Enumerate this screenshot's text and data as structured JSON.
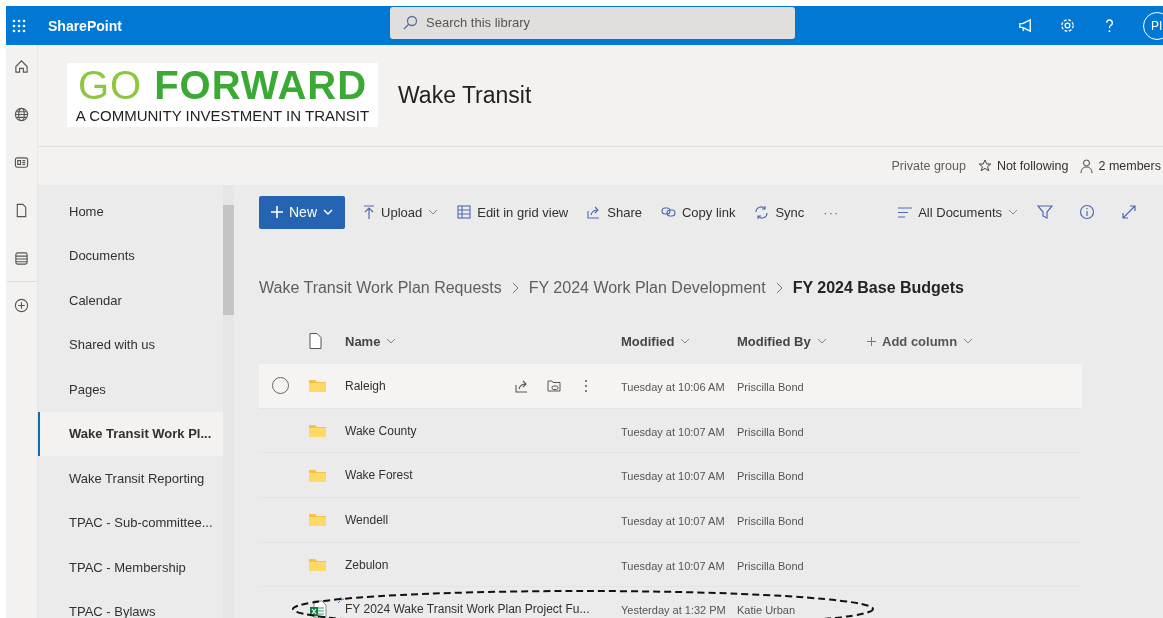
{
  "app_bar": {
    "app_name": "SharePoint",
    "search": {
      "placeholder": "Search this library"
    },
    "avatar": "PI"
  },
  "site": {
    "logo_line1a": "GO",
    "logo_line1b": "FORWARD",
    "logo_line2": "A COMMUNITY INVESTMENT IN TRANSIT",
    "title": "Wake Transit"
  },
  "site_info": {
    "privacy": "Private group",
    "follow": "Not following",
    "members": "2 members"
  },
  "nav": [
    {
      "label": "Home",
      "selected": false
    },
    {
      "label": "Documents",
      "selected": false
    },
    {
      "label": "Calendar",
      "selected": false
    },
    {
      "label": "Shared with us",
      "selected": false
    },
    {
      "label": "Pages",
      "selected": false
    },
    {
      "label": "Wake Transit Work Pl...",
      "selected": true
    },
    {
      "label": "Wake Transit Reporting",
      "selected": false
    },
    {
      "label": "TPAC - Sub-committee...",
      "selected": false
    },
    {
      "label": "TPAC - Membership",
      "selected": false
    },
    {
      "label": "TPAC - Bylaws",
      "selected": false
    }
  ],
  "commands": {
    "new": "New",
    "upload": "Upload",
    "grid": "Edit in grid view",
    "share": "Share",
    "copy_link": "Copy link",
    "sync": "Sync",
    "more": "···",
    "view": "All Documents"
  },
  "breadcrumb": [
    {
      "label": "Wake Transit Work Plan Requests",
      "current": false
    },
    {
      "label": "FY 2024 Work Plan Development",
      "current": false
    },
    {
      "label": "FY 2024 Base Budgets",
      "current": true
    }
  ],
  "table": {
    "columns": [
      "Name",
      "Modified",
      "Modified By",
      "Add column"
    ],
    "rows": [
      {
        "kind": "folder",
        "name": "Raleigh",
        "modified": "Tuesday at 10:06 AM",
        "modified_by": "Priscilla Bond",
        "hovered": true
      },
      {
        "kind": "folder",
        "name": "Wake County",
        "modified": "Tuesday at 10:07 AM",
        "modified_by": "Priscilla Bond",
        "hovered": false
      },
      {
        "kind": "folder",
        "name": "Wake Forest",
        "modified": "Tuesday at 10:07 AM",
        "modified_by": "Priscilla Bond",
        "hovered": false
      },
      {
        "kind": "folder",
        "name": "Wendell",
        "modified": "Tuesday at 10:07 AM",
        "modified_by": "Priscilla Bond",
        "hovered": false
      },
      {
        "kind": "folder",
        "name": "Zebulon",
        "modified": "Tuesday at 10:07 AM",
        "modified_by": "Priscilla Bond",
        "hovered": false
      },
      {
        "kind": "excel",
        "name": "FY 2024 Wake Transit Work Plan Project Fu...",
        "modified": "Yesterday at 1:32 PM",
        "modified_by": "Katie Urban",
        "hovered": false,
        "new": true,
        "circled": true
      }
    ]
  }
}
